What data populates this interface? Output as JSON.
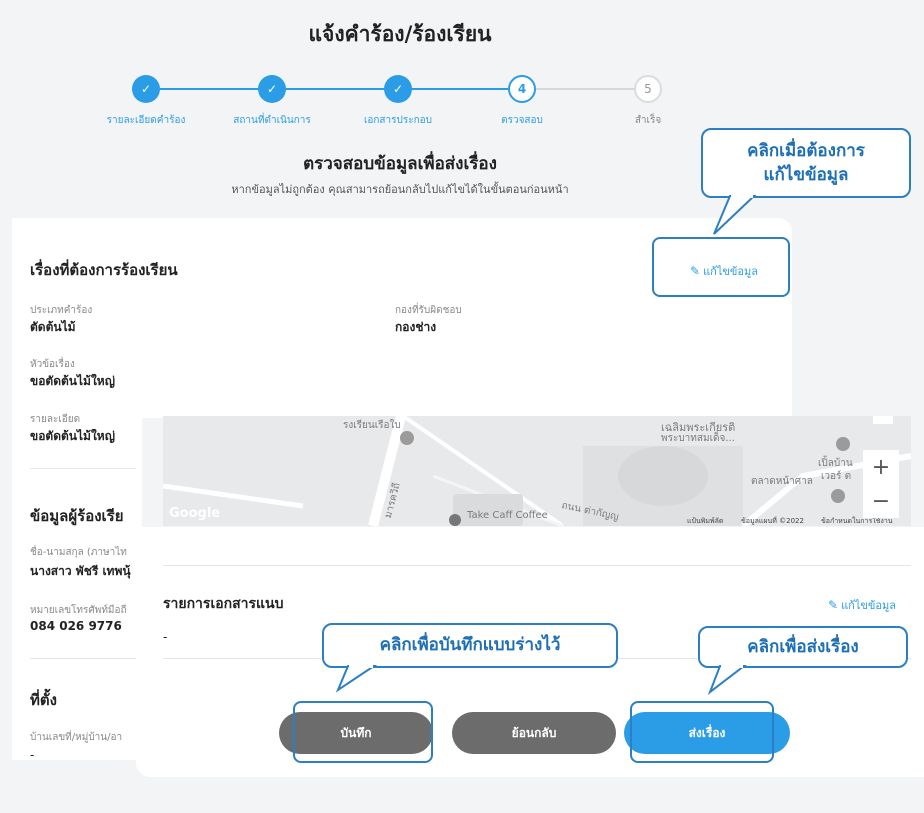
{
  "header": {
    "title": "แจ้งคำร้อง/ร้องเรียน"
  },
  "stepper": {
    "steps": [
      {
        "label": "รายละเอียดคำร้อง",
        "number": "✓",
        "state": "done"
      },
      {
        "label": "สถานที่ดำเนินการ",
        "number": "✓",
        "state": "done"
      },
      {
        "label": "เอกสารประกอบ",
        "number": "✓",
        "state": "done"
      },
      {
        "label": "ตรวจสอบ",
        "number": "4",
        "state": "active"
      },
      {
        "label": "สำเร็จ",
        "number": "5",
        "state": "pending"
      }
    ]
  },
  "review": {
    "title": "ตรวจสอบข้อมูลเพื่อส่งเรื่อง",
    "subtitle": "หากข้อมูลไม่ถูกต้อง คุณสามารถย้อนกลับไปแก้ไขได้ในขั้นตอนก่อนหน้า"
  },
  "callouts": {
    "edit": "คลิกเมื่อต้องการ\nแก้ไขข้อมูล",
    "save_draft": "คลิกเพื่อบันทึกแบบร่างไว้",
    "submit": "คลิกเพื่อส่งเรื่อง"
  },
  "complaint": {
    "heading": "เรื่องที่ต้องการร้องเรียน",
    "edit_label": "แก้ไขข้อมูล",
    "type_label": "ประเภทคำร้อง",
    "type_value": "ตัดต้นไม้",
    "division_label": "กองที่รับผิดชอบ",
    "division_value": "กองช่าง",
    "subject_label": "หัวข้อเรื่อง",
    "subject_value": "ขอตัดต้นไม้ใหญ่",
    "detail_label": "รายละเอียด",
    "detail_value": "ขอตัดต้นไม้ใหญ่"
  },
  "complainant": {
    "heading": "ข้อมูลผู้ร้องเรีย",
    "name_label": "ชื่อ-นามสกุล (ภาษาไท",
    "name_value": "นางสาว พัชรี เทพนุ้",
    "phone_label": "หมายเลขโทรศัพท์มือถื",
    "phone_value": "084 026 9776"
  },
  "location": {
    "heading": "ที่ตั้ง",
    "address_label": "บ้านเลขที่/หมู่บ้าน/อา",
    "address_value": "-"
  },
  "map": {
    "labels": {
      "school": "รงเรียนเรือใบ",
      "park_1": "เฉลิมพระเกียรติ",
      "park_2": "พระบาทสมเด็จ...",
      "road": "มารควิถี",
      "cafe": "Take Caff Coffee",
      "market": "ตลาดหน้าศาล",
      "right_1": "เปิ้ลบ้าน",
      "right_2": "เวอร์ ต",
      "street": "ถนน ต่ากัญญ",
      "google": "Google",
      "shortcuts": "แป้นพิมพ์ลัด",
      "map_data": "ข้อมูลแผนที่ ©2022",
      "terms": "ข้อกำหนดในการใช้งาน"
    },
    "zoom_in": "+",
    "zoom_out": "−"
  },
  "attachments": {
    "heading": "รายการเอกสารแนบ",
    "edit_label": "แก้ไขข้อมูล",
    "value": "-"
  },
  "buttons": {
    "save": "บันทึก",
    "back": "ย้อนกลับ",
    "submit": "ส่งเรื่อง"
  },
  "colors": {
    "accent": "#2b9de6",
    "callout_border": "#2b7fc2",
    "button_gray": "#6c6c6c"
  }
}
